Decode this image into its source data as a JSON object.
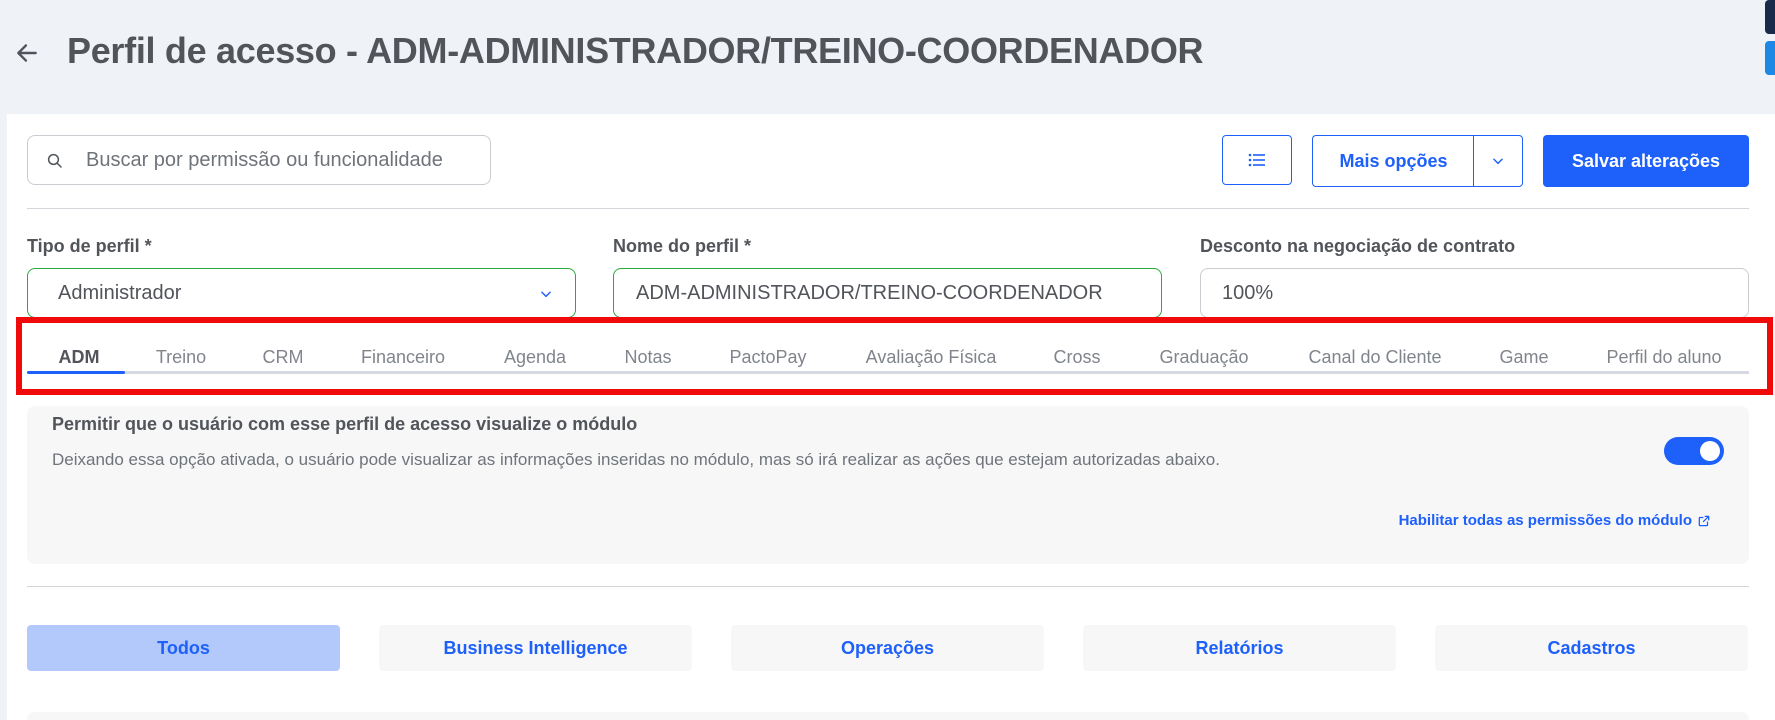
{
  "header": {
    "title": "Perfil de acesso - ADM-ADMINISTRADOR/TREINO-COORDENADOR"
  },
  "toolbar": {
    "search_placeholder": "Buscar por permissão ou funcionalidade",
    "more_options_label": "Mais opções",
    "save_label": "Salvar alterações"
  },
  "form": {
    "profile_type": {
      "label": "Tipo de perfil *",
      "value": "Administrador"
    },
    "profile_name": {
      "label": "Nome do perfil *",
      "value": "ADM-ADMINISTRADOR/TREINO-COORDENADOR"
    },
    "discount": {
      "label": "Desconto na negociação de contrato",
      "value": "100%"
    }
  },
  "tabs": [
    {
      "label": "ADM",
      "active": true
    },
    {
      "label": "Treino"
    },
    {
      "label": "CRM"
    },
    {
      "label": "Financeiro"
    },
    {
      "label": "Agenda"
    },
    {
      "label": "Notas"
    },
    {
      "label": "PactoPay"
    },
    {
      "label": "Avaliação Física"
    },
    {
      "label": "Cross"
    },
    {
      "label": "Graduação"
    },
    {
      "label": "Canal do Cliente"
    },
    {
      "label": "Game"
    },
    {
      "label": "Perfil do aluno"
    }
  ],
  "module_access": {
    "title": "Permitir que o usuário com esse perfil de acesso visualize o módulo",
    "description": "Deixando essa opção ativada, o usuário pode visualizar as informações inseridas no módulo, mas só irá realizar as ações que estejam autorizadas abaixo.",
    "enabled": true,
    "enable_all_label": "Habilitar todas as permissões do módulo"
  },
  "filters": [
    {
      "label": "Todos",
      "active": true
    },
    {
      "label": "Business Intelligence"
    },
    {
      "label": "Operações"
    },
    {
      "label": "Relatórios"
    },
    {
      "label": "Cadastros"
    }
  ],
  "colors": {
    "accent": "#1e60fa",
    "valid_border": "#28ab3b",
    "highlight": "#f00a0a",
    "filter_active_bg": "#b3c8fb"
  }
}
